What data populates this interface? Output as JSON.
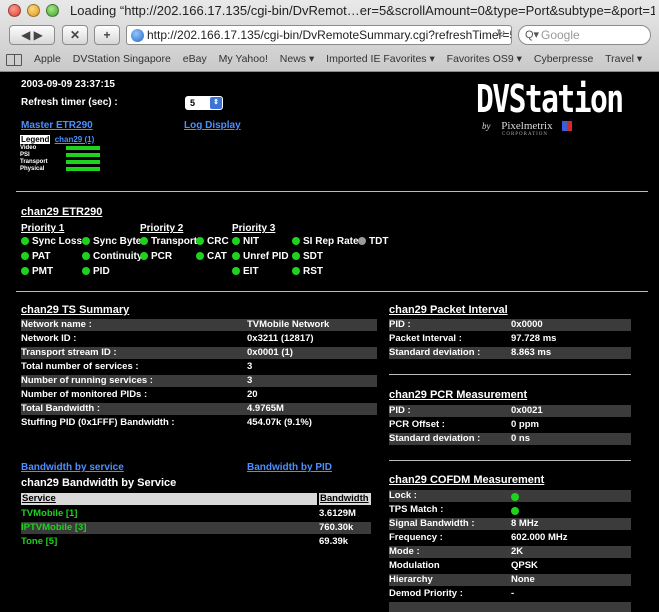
{
  "browser": {
    "window_title": "Loading “http://202.166.17.135/cgi-bin/DvRemot…er=5&scrollAmount=0&type=Port&subtype=&port=1”",
    "url": "http://202.166.17.135/cgi-bin/DvRemoteSummary.cgi?refreshTimer=5&",
    "search_placeholder": "Google",
    "back_label": "◀ ▶",
    "stop_label": "✕",
    "add_label": "+",
    "bookmarks": [
      "Apple",
      "DVStation Singapore",
      "eBay",
      "My Yahoo!",
      "News ▾",
      "Imported IE Favorites ▾",
      "Favorites OS9 ▾",
      "Cyberpresse",
      "Travel ▾"
    ]
  },
  "header": {
    "datetime": "2003-09-09 23:37:15",
    "refresh_label": "Refresh timer (sec) :",
    "refresh_value": "5",
    "master_link": "Master ETR290",
    "log_link": "Log Display",
    "logo": "DVStation",
    "by": "by",
    "company": "Pixelmetrix",
    "company_sub": "CORPORATION"
  },
  "legend": {
    "title": "Legend",
    "channel": "chan29 (1)",
    "rows": [
      "Video",
      "PSI",
      "Transport",
      "Physical"
    ]
  },
  "etr": {
    "title": "chan29 ETR290",
    "priority1": "Priority 1",
    "priority2": "Priority 2",
    "priority3": "Priority 3",
    "items": {
      "sync_loss": "Sync Loss",
      "sync_byte": "Sync Byte",
      "transport": "Transport",
      "crc": "CRC",
      "nit": "NIT",
      "si_rep_rate": "SI Rep Rate",
      "tdt": "TDT",
      "pat": "PAT",
      "continuity": "Continuity",
      "pcr": "PCR",
      "cat": "CAT",
      "unref_pid": "Unref PID",
      "sdt": "SDT",
      "pmt": "PMT",
      "pid": "PID",
      "eit": "EIT",
      "rst": "RST"
    }
  },
  "ts_summary": {
    "title": "chan29 TS Summary",
    "rows": [
      {
        "label": "Network name :",
        "value": "TVMobile Network"
      },
      {
        "label": "Network ID :",
        "value": "0x3211 (12817)"
      },
      {
        "label": "Transport stream ID :",
        "value": "0x0001 (1)"
      },
      {
        "label": "Total number of services :",
        "value": "3"
      },
      {
        "label": "Number of running services :",
        "value": "3"
      },
      {
        "label": "Number of monitored PIDs :",
        "value": "20"
      },
      {
        "label": "Total Bandwidth :",
        "value": "4.9765M"
      },
      {
        "label": "Stuffing PID (0x1FFF) Bandwidth :",
        "value": "454.07k (9.1%)"
      }
    ]
  },
  "packet_interval": {
    "title": "chan29 Packet Interval",
    "rows": [
      {
        "label": "PID :",
        "value": "0x0000"
      },
      {
        "label": "Packet Interval :",
        "value": "97.728 ms"
      },
      {
        "label": "Standard deviation :",
        "value": "8.863 ms"
      }
    ]
  },
  "pcr": {
    "title": "chan29 PCR Measurement",
    "rows": [
      {
        "label": "PID :",
        "value": "0x0021"
      },
      {
        "label": "PCR Offset :",
        "value": "0 ppm"
      },
      {
        "label": "Standard deviation :",
        "value": "0 ns"
      }
    ]
  },
  "bandwidth": {
    "by_service_link": "Bandwidth by service",
    "by_pid_link": "Bandwidth by PID",
    "title": "chan29 Bandwidth by Service",
    "col_service": "Service",
    "col_bandwidth": "Bandwidth",
    "rows": [
      {
        "service": "TVMobile [1]",
        "bandwidth": "3.6129M"
      },
      {
        "service": "IPTVMobile [3]",
        "bandwidth": "760.30k"
      },
      {
        "service": "Tone [5]",
        "bandwidth": "69.39k"
      }
    ]
  },
  "cofdm": {
    "title": "chan29 COFDM Measurement",
    "rows": [
      {
        "label": "Lock :",
        "value": ""
      },
      {
        "label": "TPS Match :",
        "value": ""
      },
      {
        "label": "Signal Bandwidth :",
        "value": "8 MHz"
      },
      {
        "label": "Frequency :",
        "value": "602.000 MHz"
      },
      {
        "label": "Mode :",
        "value": "2K"
      },
      {
        "label": "Modulation",
        "value": "QPSK"
      },
      {
        "label": "Hierarchy",
        "value": "None"
      },
      {
        "label": "Demod Priority :",
        "value": "-"
      }
    ]
  },
  "colors": {
    "ok": "#1ed31e",
    "inactive": "#9a9a9a",
    "link": "#4d8fff",
    "row_shade": "#3b3b3b"
  }
}
